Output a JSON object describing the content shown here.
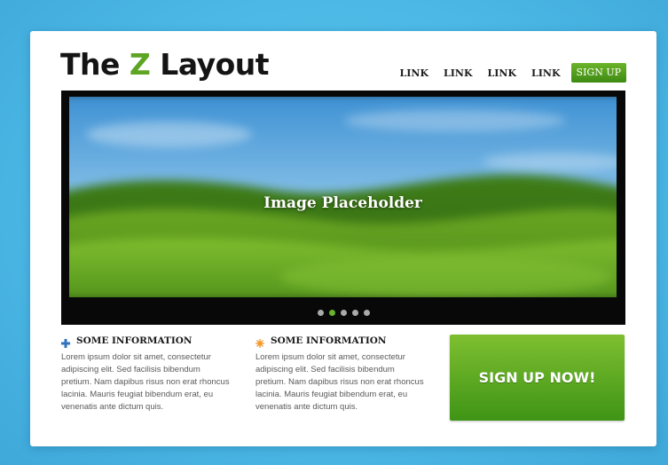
{
  "header": {
    "logo_pre": "The ",
    "logo_z": "Z",
    "logo_post": " Layout",
    "nav_links": [
      "LINK",
      "LINK",
      "LINK",
      "LINK"
    ],
    "signup_label": "SIGN UP"
  },
  "slider": {
    "caption": "Image Placeholder",
    "dot_count": 5,
    "active_dot_index": 1
  },
  "info_blocks": [
    {
      "icon": "plus-icon",
      "title": "SOME INFORMATION",
      "text": "Lorem ipsum dolor sit amet, consectetur adipiscing elit. Sed facilisis bibendum pretium. Nam dapibus risus non erat rhoncus lacinia. Mauris feugiat bibendum erat, eu venenatis ante dictum quis."
    },
    {
      "icon": "sun-icon",
      "title": "SOME INFORMATION",
      "text": "Lorem ipsum dolor sit amet, consectetur adipiscing elit. Sed facilisis bibendum pretium. Nam dapibus risus non erat rhoncus lacinia. Mauris feugiat bibendum erat, eu venenatis ante dictum quis."
    }
  ],
  "cta": {
    "label": "SIGN UP NOW!"
  },
  "colors": {
    "background": "#4cb9e6",
    "accent_green": "#5fa524",
    "plus_icon": "#2f74c0",
    "sun_icon": "#f39a2c"
  }
}
